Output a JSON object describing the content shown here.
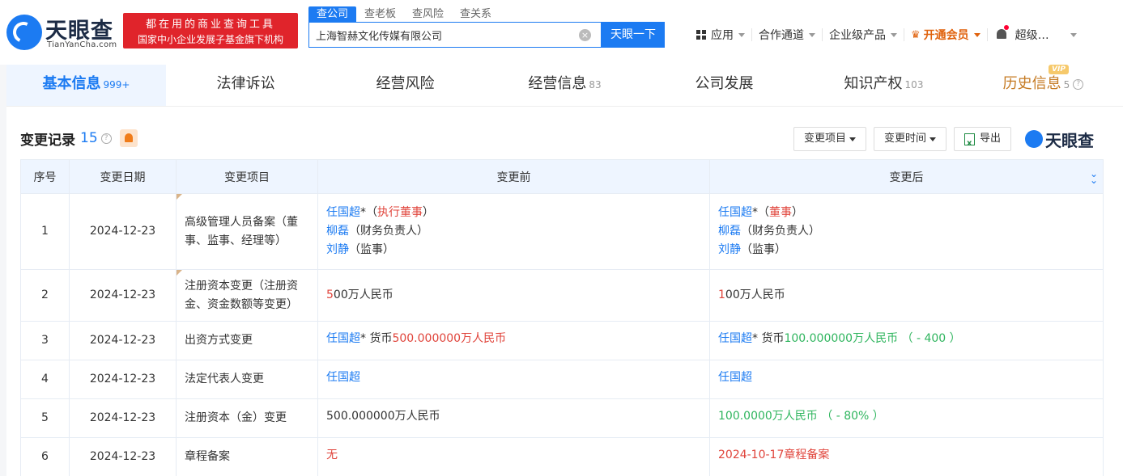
{
  "header": {
    "logo_text": "天眼查",
    "logo_sub": "TianYanCha.com",
    "banner_line1": "都在用的商业查询工具",
    "banner_line2": "国家中小企业发展子基金旗下机构",
    "search_tabs": [
      "查公司",
      "查老板",
      "查风险",
      "查关系"
    ],
    "search_value": "上海智赫文化传媒有限公司",
    "search_button": "天眼一下",
    "nav": {
      "apps": "应用",
      "channels": "合作通道",
      "enterprise": "企业级产品",
      "vip": "开通会员",
      "user": "超级…"
    }
  },
  "tabs": [
    {
      "label": "基本信息",
      "count": "999+"
    },
    {
      "label": "法律诉讼",
      "count": ""
    },
    {
      "label": "经营风险",
      "count": ""
    },
    {
      "label": "经营信息",
      "count": "83"
    },
    {
      "label": "公司发展",
      "count": ""
    },
    {
      "label": "知识产权",
      "count": "103"
    },
    {
      "label": "历史信息",
      "count": "5"
    }
  ],
  "vip_badge": "VIP",
  "section": {
    "title": "变更记录",
    "count": "15",
    "filter_item": "变更项目",
    "filter_time": "变更时间",
    "export": "导出",
    "brand": "天眼查"
  },
  "table": {
    "headers": [
      "序号",
      "变更日期",
      "变更项目",
      "变更前",
      "变更后"
    ],
    "rows": [
      {
        "no": "1",
        "date": "2024-12-23",
        "item": "高级管理人员备案（董事、监事、经理等）"
      },
      {
        "no": "2",
        "date": "2024-12-23",
        "item": "注册资本变更（注册资金、资金数额等变更）"
      },
      {
        "no": "3",
        "date": "2024-12-23",
        "item": "出资方式变更"
      },
      {
        "no": "4",
        "date": "2024-12-23",
        "item": "法定代表人变更"
      },
      {
        "no": "5",
        "date": "2024-12-23",
        "item": "注册资本（金）变更"
      },
      {
        "no": "6",
        "date": "2024-12-23",
        "item": "章程备案"
      }
    ],
    "r1": {
      "before": {
        "p1": "任国超",
        "p1_star": "*",
        "p1_open": "（",
        "p1_role": "执行董事",
        "p1_close": "）",
        "p2": "柳磊",
        "p2_role": "（财务负责人）",
        "p3": "刘静",
        "p3_role": "（监事）"
      },
      "after": {
        "p1": "任国超",
        "p1_star": "*",
        "p1_open": "（",
        "p1_role": "董事",
        "p1_close": "）",
        "p2": "柳磊",
        "p2_role": "（财务负责人）",
        "p3": "刘静",
        "p3_role": "（监事）"
      }
    },
    "r2": {
      "before_hl": "5",
      "before_rest": "00万人民币",
      "after_hl": "1",
      "after_rest": "00万人民币"
    },
    "r3": {
      "before_name": "任国超",
      "before_mid": "* 货币",
      "before_amount": "500.000000万人民币",
      "after_name": "任国超",
      "after_mid": "* 货币",
      "after_amount": "100.000000万人民币 （ - 400 ）"
    },
    "r4": {
      "before": "任国超",
      "after": "任国超"
    },
    "r5": {
      "before": "500.000000万人民币",
      "after": "100.0000万人民币 （ - 80% ）"
    },
    "r6": {
      "before": "无",
      "after": "2024-10-17章程备案"
    }
  }
}
